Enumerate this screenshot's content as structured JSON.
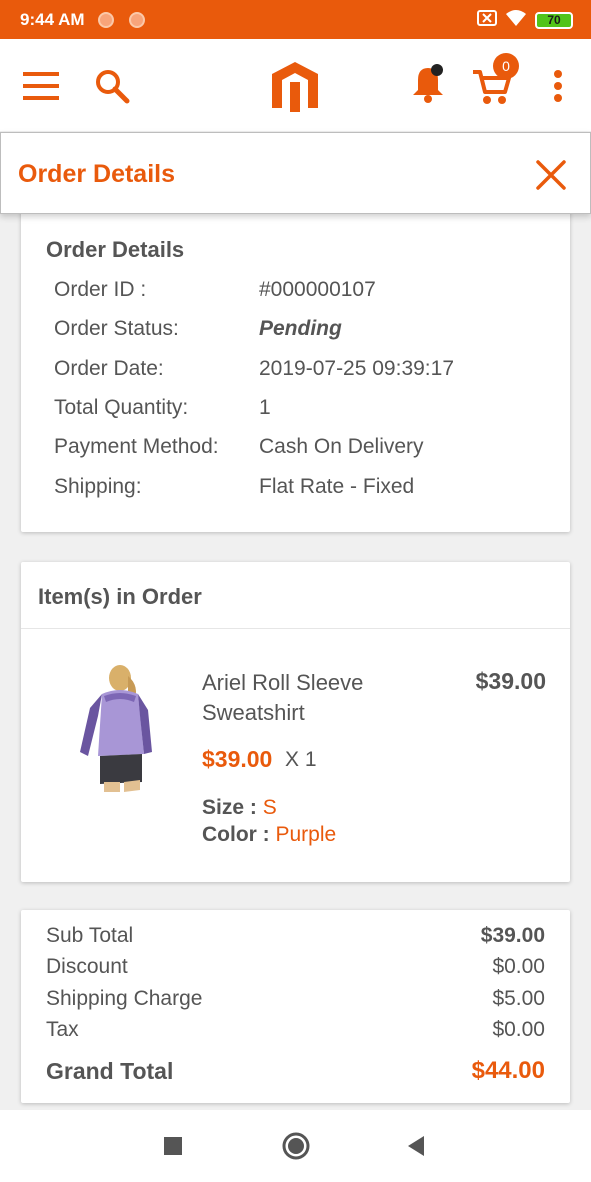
{
  "status_bar": {
    "time": "9:44 AM",
    "battery": "70"
  },
  "app_bar": {
    "cart_count": "0"
  },
  "header": {
    "title": "Order Details"
  },
  "order_details": {
    "heading": "Order Details",
    "rows": [
      {
        "label": "Order ID :",
        "value": "#000000107"
      },
      {
        "label": "Order Status:",
        "value": "Pending"
      },
      {
        "label": "Order Date:",
        "value": "2019-07-25 09:39:17"
      },
      {
        "label": "Total Quantity:",
        "value": "1"
      },
      {
        "label": "Payment Method:",
        "value": "Cash On Delivery"
      },
      {
        "label": "Shipping:",
        "value": "Flat Rate - Fixed"
      }
    ]
  },
  "items": {
    "heading": "Item(s) in Order",
    "product": {
      "name": "Ariel Roll Sleeve Sweatshirt",
      "price": "$39.00",
      "unit_price": "$39.00",
      "quantity": "X 1",
      "size_label": "Size :",
      "size_value": "S",
      "color_label": "Color :",
      "color_value": "Purple"
    }
  },
  "summary": {
    "rows": [
      {
        "label": "Sub Total",
        "value": "$39.00"
      },
      {
        "label": "Discount",
        "value": "$0.00"
      },
      {
        "label": "Shipping Charge",
        "value": "$5.00"
      },
      {
        "label": "Tax",
        "value": "$0.00"
      }
    ],
    "grand_total_label": "Grand Total",
    "grand_total_value": "$44.00"
  },
  "colors": {
    "accent": "#e95a0c",
    "text": "#555555",
    "background": "#f0f0f0"
  },
  "icons": [
    "menu-icon",
    "search-icon",
    "store-logo",
    "notification-icon",
    "cart-icon",
    "more-icon",
    "close-icon",
    "stop-icon",
    "home-icon",
    "back-icon"
  ]
}
